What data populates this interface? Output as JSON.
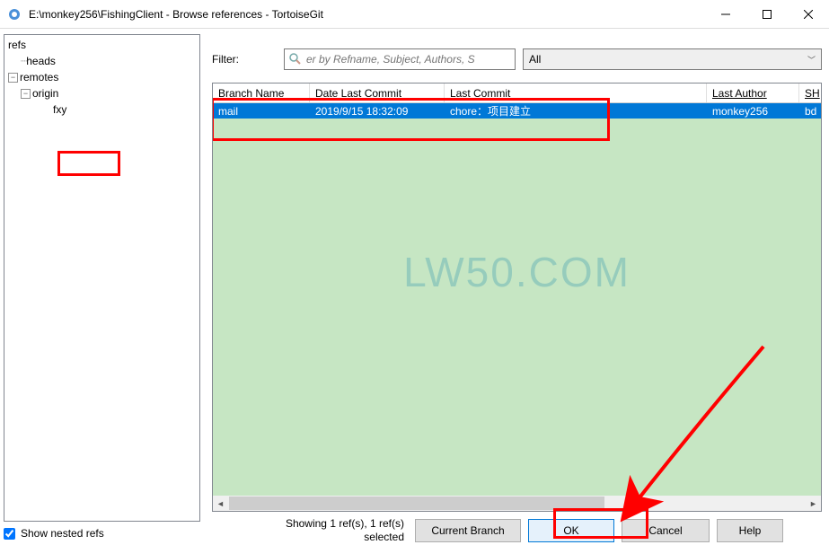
{
  "window": {
    "title": "E:\\monkey256\\FishingClient - Browse references - TortoiseGit"
  },
  "filter": {
    "label": "Filter:",
    "placeholder": "er by Refname, Subject, Authors, S",
    "dropdown": "All"
  },
  "tree": {
    "root": "refs",
    "heads": "heads",
    "remotes": "remotes",
    "origin": "origin",
    "fxy": "fxy"
  },
  "showNested": "Show nested refs",
  "columns": {
    "branchName": "Branch Name",
    "dateLastCommit": "Date Last Commit",
    "lastCommit": "Last Commit",
    "lastAuthor": "Last Author",
    "sha": "SH"
  },
  "rows": [
    {
      "branchName": "mail",
      "dateLastCommit": "2019/9/15 18:32:09",
      "lastCommit": "chore：项目建立",
      "lastAuthor": "monkey256",
      "sha": "bd"
    }
  ],
  "watermark": "LW50.COM",
  "status": {
    "line1": "Showing 1 ref(s), 1 ref(s)",
    "line2": "selected"
  },
  "buttons": {
    "currentBranch": "Current Branch",
    "ok": "OK",
    "cancel": "Cancel",
    "help": "Help"
  }
}
